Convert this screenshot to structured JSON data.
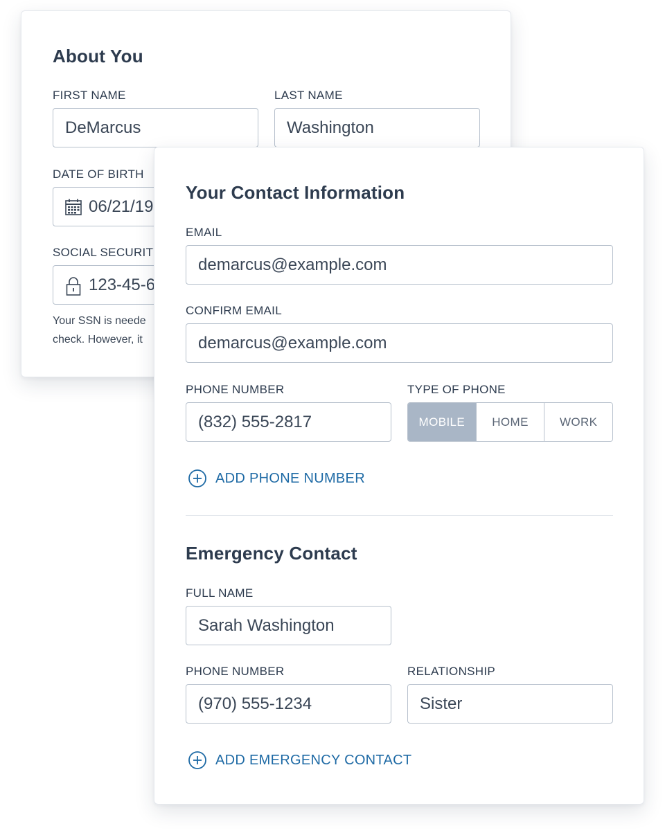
{
  "about": {
    "title": "About You",
    "first_name_label": "FIRST NAME",
    "first_name_value": "DeMarcus",
    "last_name_label": "LAST NAME",
    "last_name_value": "Washington",
    "dob_label": "DATE OF BIRTH",
    "dob_value": "06/21/19",
    "ssn_label": "SOCIAL SECURITY",
    "ssn_value": "123-45-6",
    "ssn_help_line1": "Your SSN is neede",
    "ssn_help_line2": "check. However, it",
    "dob_icon": "calendar-icon",
    "ssn_icon": "lock-icon"
  },
  "contact": {
    "title": "Your Contact Information",
    "email_label": "EMAIL",
    "email_value": "demarcus@example.com",
    "confirm_email_label": "CONFIRM EMAIL",
    "confirm_email_value": "demarcus@example.com",
    "phone_label": "PHONE NUMBER",
    "phone_value": "(832) 555-2817",
    "phone_type_label": "TYPE OF PHONE",
    "phone_types": [
      "MOBILE",
      "HOME",
      "WORK"
    ],
    "phone_type_selected": "MOBILE",
    "add_phone_label": "ADD PHONE NUMBER",
    "add_icon": "plus-circle-icon"
  },
  "emergency": {
    "title": "Emergency Contact",
    "full_name_label": "FULL NAME",
    "full_name_value": "Sarah Washington",
    "phone_label": "PHONE NUMBER",
    "phone_value": "(970) 555-1234",
    "relationship_label": "RELATIONSHIP",
    "relationship_value": "Sister",
    "add_contact_label": "ADD EMERGENCY CONTACT"
  },
  "colors": {
    "text": "#2d3b4e",
    "link": "#1e6aa5",
    "border": "#b6c0cc",
    "selected_segment": "#a9b6c6"
  }
}
